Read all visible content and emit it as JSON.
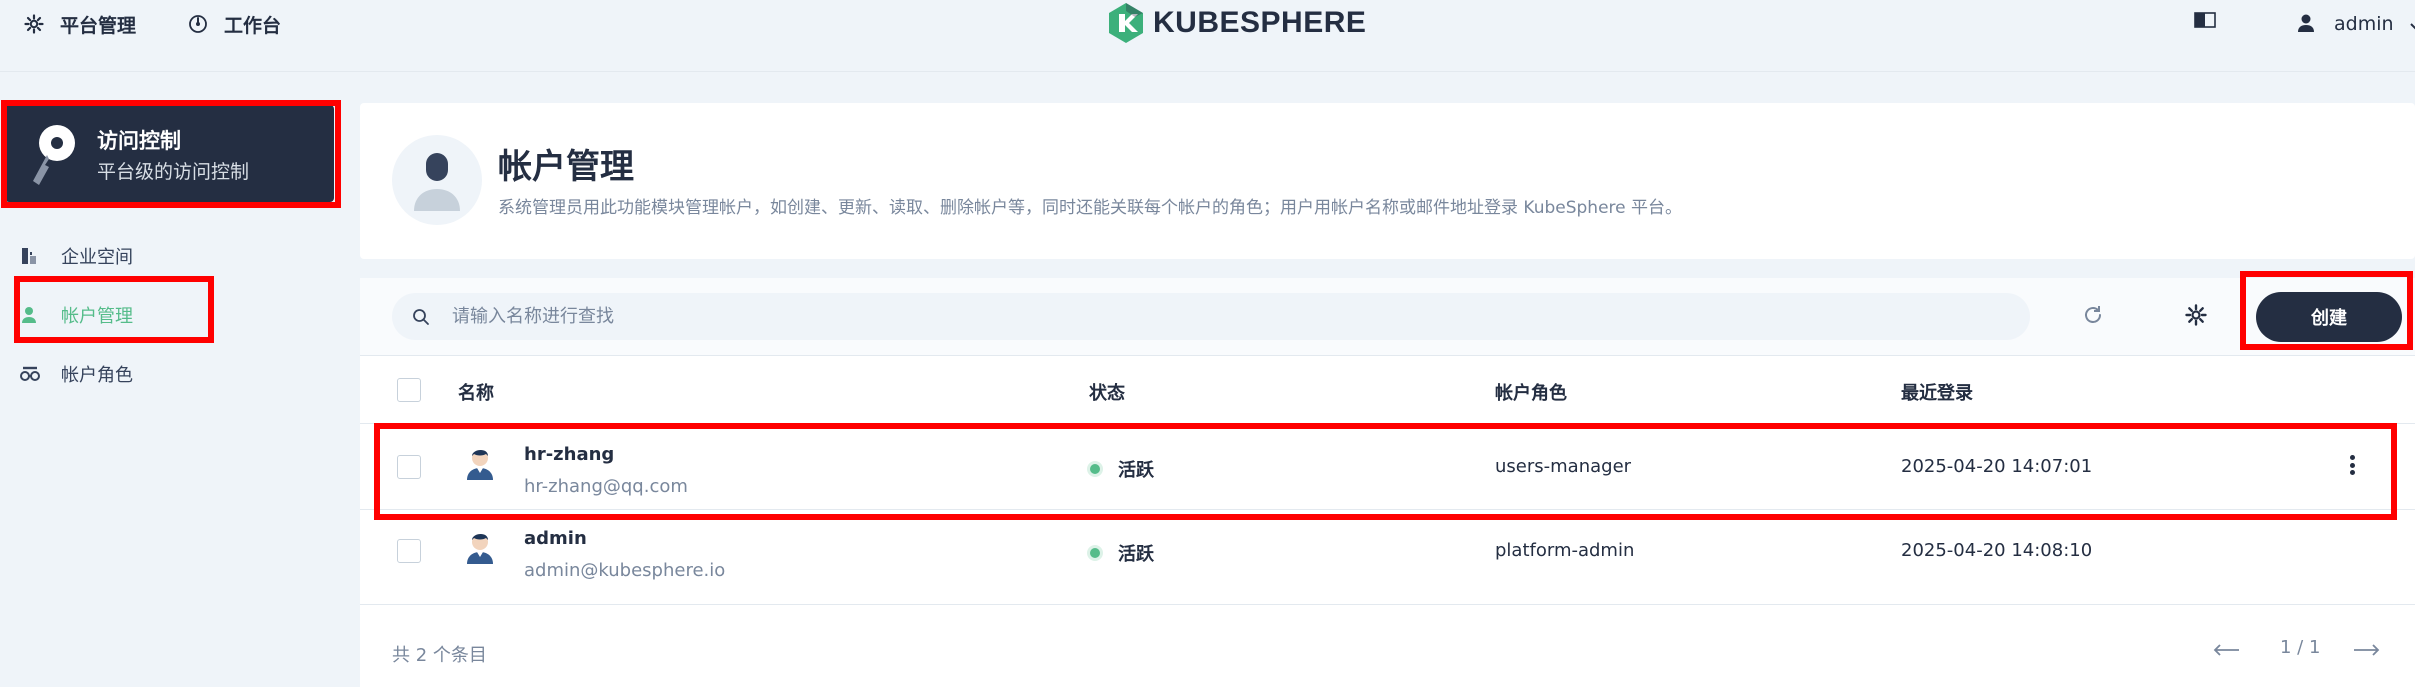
{
  "topbar": {
    "platform_label": "平台管理",
    "workbench_label": "工作台",
    "logo_text": "KUBESPHERE",
    "user_name": "admin"
  },
  "sidebar": {
    "card_title": "访问控制",
    "card_subtitle": "平台级的访问控制",
    "items": [
      {
        "label": "企业空间",
        "icon": "workspace-icon"
      },
      {
        "label": "帐户管理",
        "icon": "user-icon",
        "active": true
      },
      {
        "label": "帐户角色",
        "icon": "roles-icon"
      }
    ]
  },
  "header": {
    "title": "帐户管理",
    "description": "系统管理员用此功能模块管理帐户，如创建、更新、读取、删除帐户等，同时还能关联每个帐户的角色；用户用帐户名称或邮件地址登录 KubeSphere 平台。"
  },
  "toolbar": {
    "search_placeholder": "请输入名称进行查找",
    "create_label": "创建"
  },
  "table": {
    "columns": [
      "名称",
      "状态",
      "帐户角色",
      "最近登录"
    ],
    "rows": [
      {
        "name": "hr-zhang",
        "email": "hr-zhang@qq.com",
        "status": "活跃",
        "role": "users-manager",
        "last_login": "2025-04-20 14:07:01"
      },
      {
        "name": "admin",
        "email": "admin@kubesphere.io",
        "status": "活跃",
        "role": "platform-admin",
        "last_login": "2025-04-20 14:08:10"
      }
    ]
  },
  "footer": {
    "total": "共 2 个条目",
    "page": "1 / 1"
  },
  "colors": {
    "primary_dark": "#242e42",
    "active_green": "#55bc8a",
    "background": "#eff4f9",
    "highlight_red": "#ff0000"
  }
}
